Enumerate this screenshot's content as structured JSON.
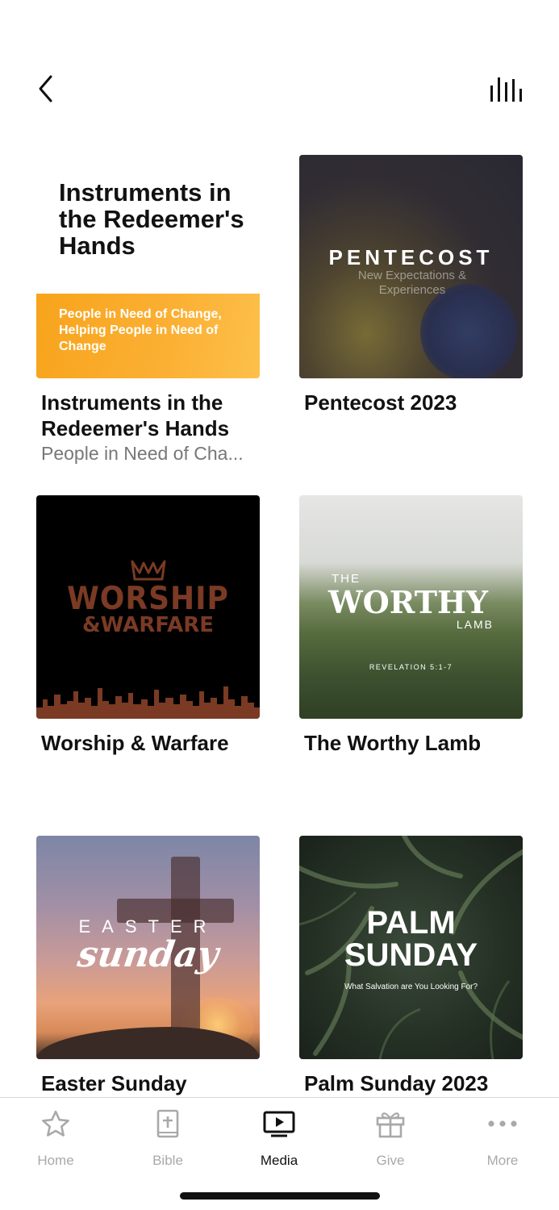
{
  "header": {
    "back_icon": "chevron-left-icon",
    "audio_icon": "audio-bars-icon"
  },
  "series": [
    {
      "title": "Instruments in the Redeemer's Hands",
      "subtitle": "People in Need of Cha...",
      "thumb_title": "Instruments in the Redeemer's Hands",
      "thumb_band": "People in Need of Change, Helping People in Need of Change"
    },
    {
      "title": "Pentecost 2023",
      "thumb_word": "PENTECOST",
      "thumb_sub": "New Expectations & Experiences"
    },
    {
      "title": "Worship & Warfare",
      "thumb_line1": "WORSHIP",
      "thumb_line2": "&WARFARE"
    },
    {
      "title": "The Worthy Lamb",
      "thumb_the": "THE",
      "thumb_main": "WORTHY",
      "thumb_lamb": "LAMB",
      "thumb_ref": "REVELATION 5:1-7"
    },
    {
      "title": "Easter Sunday",
      "thumb_line1": "EASTER",
      "thumb_line2": "sunday"
    },
    {
      "title": "Palm Sunday 2023",
      "thumb_line1": "PALM",
      "thumb_line2": "SUNDAY",
      "thumb_line3": "What Salvation are You Looking For?"
    }
  ],
  "tabs": [
    {
      "label": "Home",
      "icon": "star-icon",
      "active": false
    },
    {
      "label": "Bible",
      "icon": "bible-icon",
      "active": false
    },
    {
      "label": "Media",
      "icon": "media-icon",
      "active": true
    },
    {
      "label": "Give",
      "icon": "gift-icon",
      "active": false
    },
    {
      "label": "More",
      "icon": "more-dots-icon",
      "active": false
    }
  ],
  "colors": {
    "active_tab": "#111111",
    "inactive_tab": "#a9a9a9",
    "instruments_band": "#fbb034"
  }
}
